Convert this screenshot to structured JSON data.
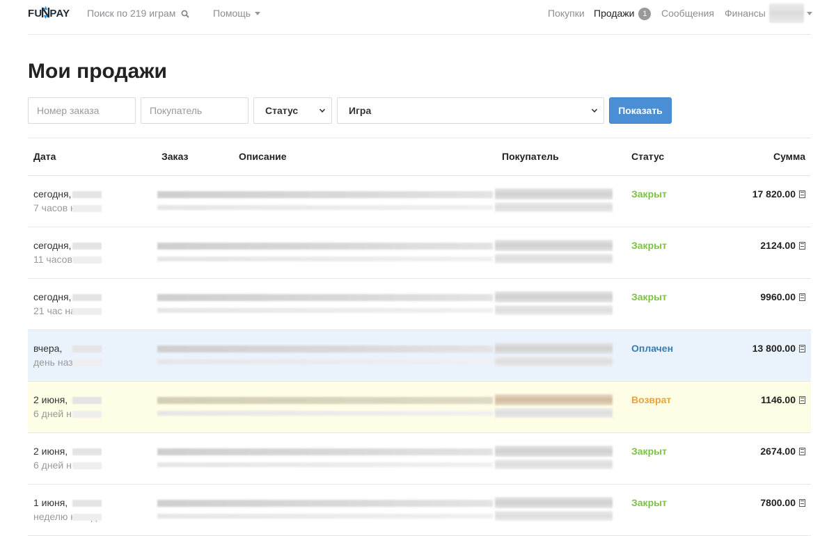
{
  "navbar": {
    "logo": "FUNPAY",
    "search": "Поиск по 219 играм",
    "help": "Помощь",
    "purchases": "Покупки",
    "sales": "Продажи",
    "sales_badge": "1",
    "messages": "Сообщения",
    "finances": "Финансы"
  },
  "page_title": "Мои продажи",
  "filters": {
    "order_placeholder": "Номер заказа",
    "buyer_placeholder": "Покупатель",
    "status_label": "Статус",
    "game_label": "Игра",
    "show_button": "Показать"
  },
  "table": {
    "headers": {
      "date": "Дата",
      "order": "Заказ",
      "description": "Описание",
      "buyer": "Покупатель",
      "status": "Статус",
      "amount": "Сумма"
    },
    "status_colors": {
      "Закрыт": "#7cc242",
      "Оплачен": "#3a7cab",
      "Возврат": "#e8a33a"
    },
    "rows": [
      {
        "date": "сегодня,",
        "ago": "7 часов н",
        "status": "Закрыт",
        "amount": "17 820.00",
        "state": "closed"
      },
      {
        "date": "сегодня,",
        "ago": "11 часов",
        "status": "Закрыт",
        "amount": "2124.00",
        "state": "closed"
      },
      {
        "date": "сегодня,",
        "ago": "21 час на",
        "status": "Закрыт",
        "amount": "9960.00",
        "state": "closed"
      },
      {
        "date": "вчера,",
        "ago": "день наз",
        "status": "Оплачен",
        "amount": "13 800.00",
        "state": "paid"
      },
      {
        "date": "2 июня,",
        "ago": "6 дней н",
        "status": "Возврат",
        "amount": "1146.00",
        "state": "refund"
      },
      {
        "date": "2 июня,",
        "ago": "6 дней н",
        "status": "Закрыт",
        "amount": "2674.00",
        "state": "closed"
      },
      {
        "date": "1 июня,",
        "ago": "неделю назад",
        "status": "Закрыт",
        "amount": "7800.00",
        "state": "closed"
      }
    ]
  }
}
